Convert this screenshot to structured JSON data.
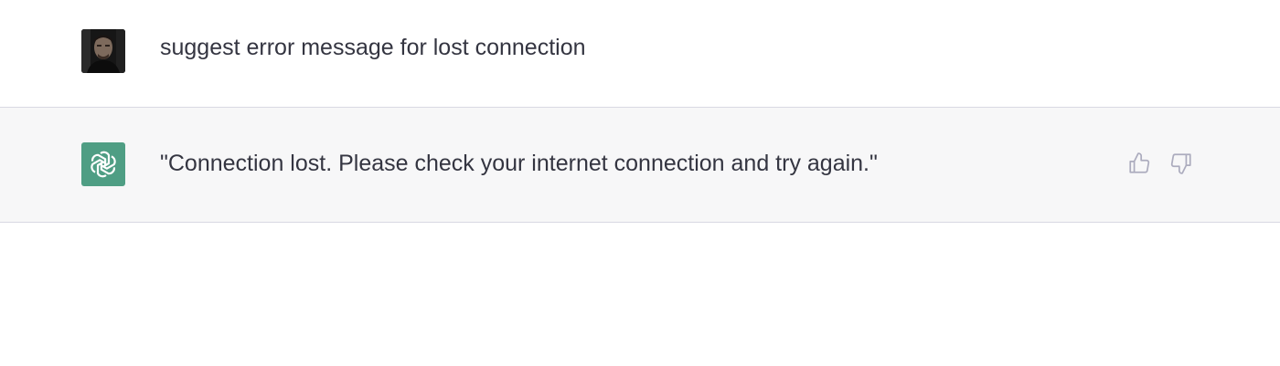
{
  "conversation": {
    "user_message": {
      "text": "suggest error message for lost connection",
      "avatar_icon": "user-photo-avatar"
    },
    "assistant_message": {
      "text": "\"Connection lost. Please check your internet connection and try again.\"",
      "avatar_icon": "openai-logo-icon",
      "avatar_color": "#4f9e84",
      "feedback": {
        "thumbs_up_icon": "thumbs-up-icon",
        "thumbs_down_icon": "thumbs-down-icon"
      }
    }
  },
  "colors": {
    "text": "#343541",
    "assistant_row_bg": "#f7f7f8",
    "divider": "#d9d9e3",
    "icon_gray": "#acacbe"
  }
}
